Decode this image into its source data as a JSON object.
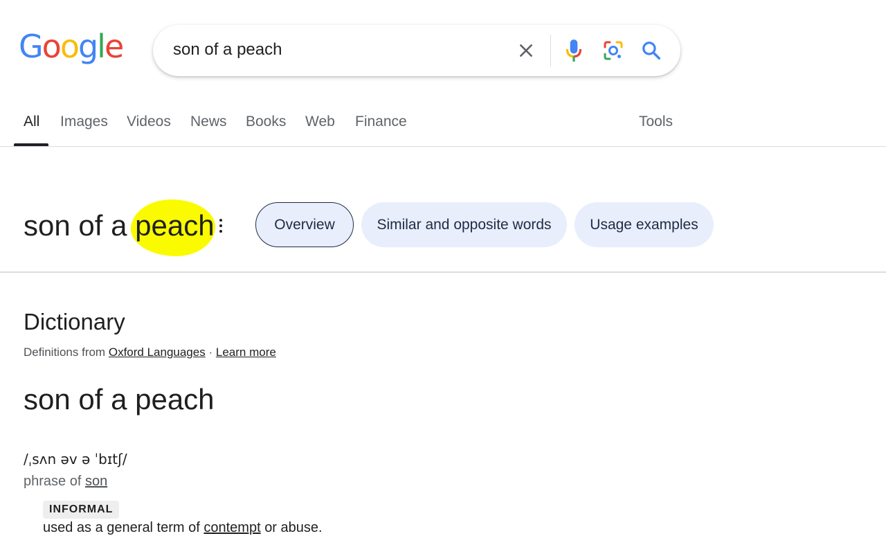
{
  "logo": {
    "letters": [
      {
        "char": "G",
        "color": "#4285F4"
      },
      {
        "char": "o",
        "color": "#EA4335"
      },
      {
        "char": "o",
        "color": "#FBBC05"
      },
      {
        "char": "g",
        "color": "#4285F4"
      },
      {
        "char": "l",
        "color": "#34A853"
      },
      {
        "char": "e",
        "color": "#EA4335"
      }
    ]
  },
  "search": {
    "value": "son of a peach",
    "icons": [
      "close-icon",
      "microphone-icon",
      "lens-icon",
      "search-icon"
    ]
  },
  "tabs": [
    {
      "label": "All",
      "active": true
    },
    {
      "label": "Images"
    },
    {
      "label": "Videos"
    },
    {
      "label": "News"
    },
    {
      "label": "Books"
    },
    {
      "label": "Web"
    },
    {
      "label": "Finance"
    }
  ],
  "tools_label": "Tools",
  "term": {
    "prefix": "son of a",
    "highlighted": "peach",
    "highlight_color": "#FBFB00"
  },
  "chips": [
    {
      "label": "Overview",
      "selected": true
    },
    {
      "label": "Similar and opposite words"
    },
    {
      "label": "Usage examples"
    }
  ],
  "dictionary": {
    "title": "Dictionary",
    "source_prefix": "Definitions from",
    "source_link": "Oxford Languages",
    "separator": "·",
    "learn_more": "Learn more",
    "headword": "son of a peach",
    "pronunciation": "/ˌsʌn əv ə ˈbɪtʃ/",
    "phrase_prefix": "phrase of",
    "phrase_link": "son",
    "register_label": "INFORMAL",
    "definition_prefix": "used as a general term of",
    "definition_link": "contempt",
    "definition_suffix": "or abuse."
  }
}
